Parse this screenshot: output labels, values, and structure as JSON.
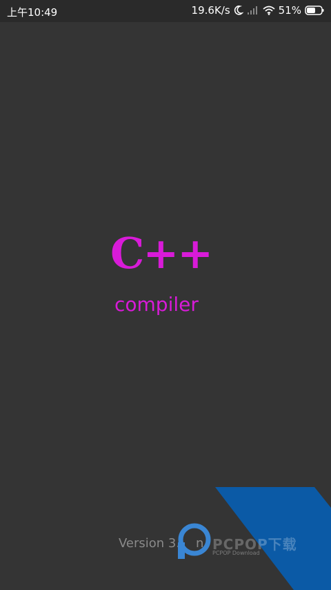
{
  "status": {
    "time": "上午10:49",
    "speed": "19.6K/s",
    "battery": "51%"
  },
  "logo": {
    "title": "C++",
    "subtitle": "compiler",
    "color": "#d81bd8"
  },
  "footer": {
    "version": "Version 3.",
    "version_suffix": "n"
  },
  "watermark": {
    "brand": "PCPOP下载",
    "sub": "PCPOP Download"
  },
  "icons": [
    "moon-icon",
    "signal-icon",
    "wifi-icon",
    "battery-icon",
    "pcpop-logo-icon"
  ]
}
